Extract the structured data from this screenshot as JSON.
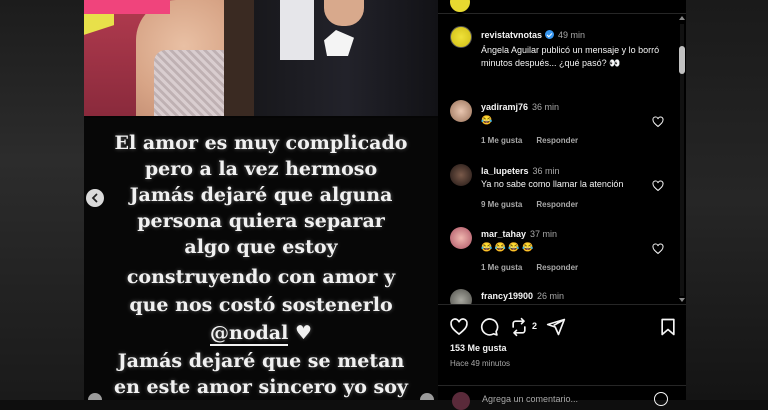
{
  "post": {
    "story_lines": [
      "El amor es muy complicado",
      "pero a la vez hermoso",
      "Jamás dejaré que alguna",
      "persona quiera separar",
      "algo que estoy",
      "construyendo con amor y",
      "que nos costó sostenerlo",
      "@nodal",
      "Jamás dejaré que se metan",
      "en este amor sincero yo soy"
    ],
    "heart_glyph": "♥"
  },
  "caption": {
    "username": "revistatvnotas",
    "time": "49 min",
    "text": "Ángela Aguilar publicó un mensaje y lo borró minutos después... ¿qué pasó? 👀"
  },
  "comments": [
    {
      "username": "yadiramj76",
      "time": "36 min",
      "text": "😂",
      "likes": "1 Me gusta",
      "reply": "Responder"
    },
    {
      "username": "la_lupeters",
      "time": "36 min",
      "text": "Ya no sabe como llamar la atención",
      "likes": "9 Me gusta",
      "reply": "Responder"
    },
    {
      "username": "mar_tahay",
      "time": "37 min",
      "text": "😂 😂 😂 😂",
      "likes": "1 Me gusta",
      "reply": "Responder"
    },
    {
      "username": "francy19900",
      "time": "26 min",
      "text": "",
      "likes": "",
      "reply": ""
    }
  ],
  "actions": {
    "repost_count": "2",
    "likes": "153 Me gusta",
    "posted": "Hace 49 minutos",
    "add_comment_placeholder": "Agrega un comentario..."
  },
  "colors": {
    "verified": "#3897f0",
    "background": "#000000",
    "secondary_text": "#a8a8a8"
  }
}
